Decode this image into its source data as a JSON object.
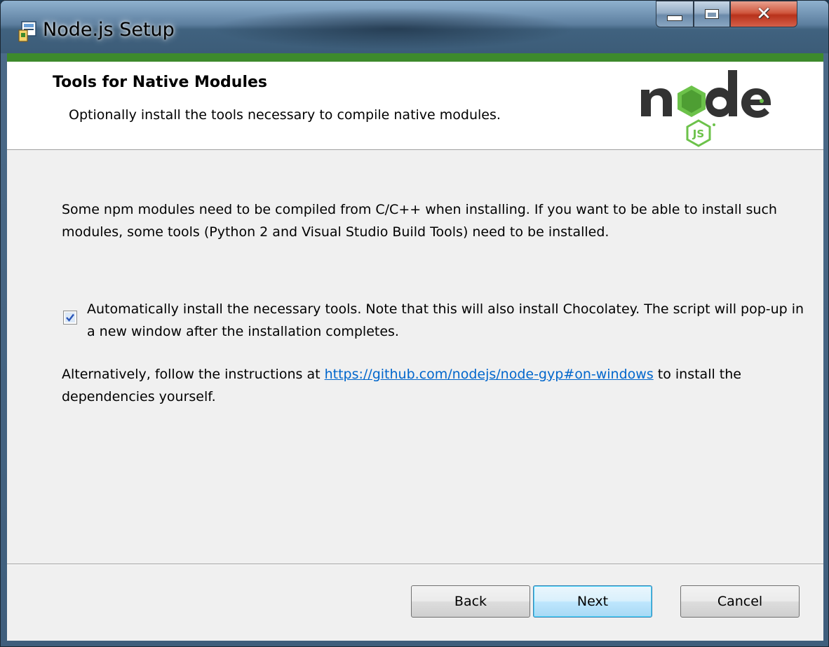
{
  "window": {
    "title": "Node.js Setup"
  },
  "header": {
    "title": "Tools for Native Modules",
    "subtitle": "Optionally install the tools necessary to compile native modules.",
    "logo_icon": "nodejs-logo"
  },
  "body": {
    "description": "Some npm modules need to be compiled from C/C++ when installing. If you want to be able to install such modules, some tools (Python 2 and Visual Studio Build Tools) need to be installed.",
    "checkbox": {
      "checked": true,
      "label": "Automatically install the necessary tools. Note that this will also install Chocolatey. The script will pop-up in a new window after the installation completes."
    },
    "alternative_prefix": "Alternatively, follow the instructions at",
    "alternative_link": "https://github.com/nodejs/node-gyp#on-windows",
    "alternative_suffix": "to install the dependencies yourself."
  },
  "footer": {
    "back_label": "Back",
    "next_label": "Next",
    "cancel_label": "Cancel"
  },
  "colors": {
    "accent_green": "#3d8a2c",
    "link_blue": "#0066cc",
    "close_red": "#c7432b"
  }
}
